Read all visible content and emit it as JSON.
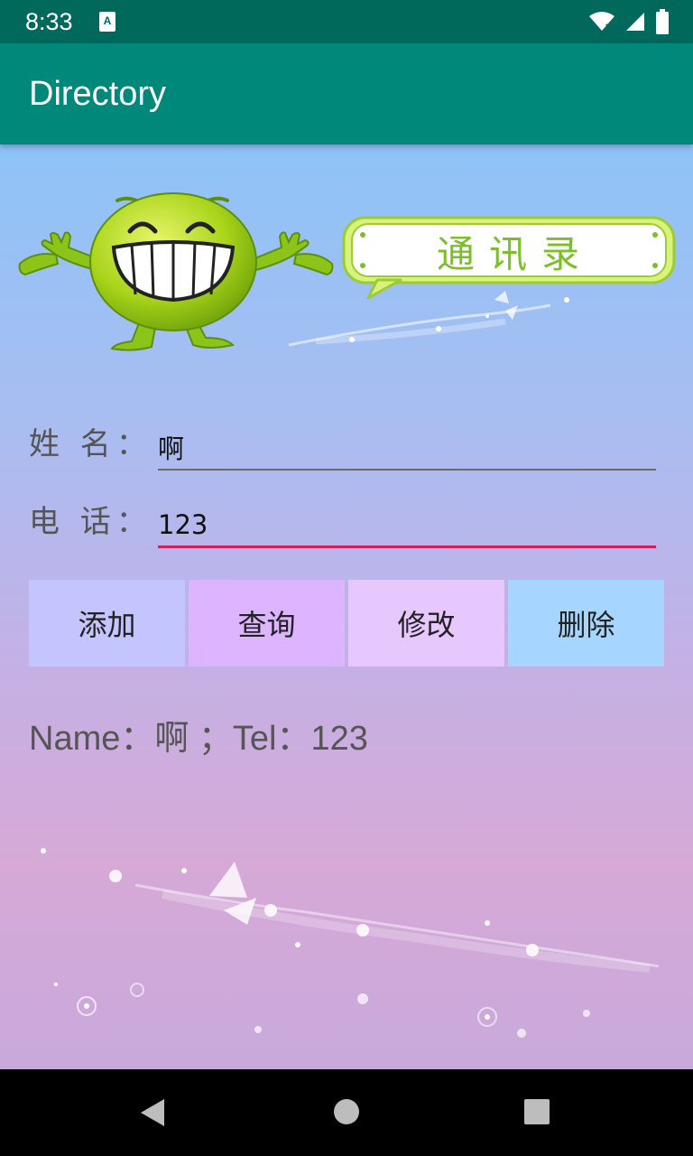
{
  "status_bar": {
    "time": "8:33",
    "notification_icon": "accessibility-notification-icon",
    "icons": [
      "wifi-icon",
      "signal-icon",
      "battery-icon"
    ]
  },
  "app_bar": {
    "title": "Directory"
  },
  "header_graphic": {
    "mascot_icon": "smiling-green-mascot-icon",
    "bubble_text": "通讯录"
  },
  "form": {
    "name_label": "姓 名：",
    "name_value": "啊",
    "phone_label": "电 话：",
    "phone_value": "123"
  },
  "buttons": {
    "add": "添加",
    "query": "查询",
    "modify": "修改",
    "delete": "删除"
  },
  "result_text": "Name：啊 ；Tel：123",
  "nav_bar": {
    "icons": [
      "back-icon",
      "home-icon",
      "recents-icon"
    ]
  },
  "colors": {
    "status_bar": "#00695c",
    "app_bar": "#00897b",
    "accent_underline": "#d81b60",
    "btn_add": "#c4c4ff",
    "btn_query": "#dcb4ff",
    "btn_modify": "#e6c8ff",
    "btn_delete": "#a6d6ff"
  }
}
